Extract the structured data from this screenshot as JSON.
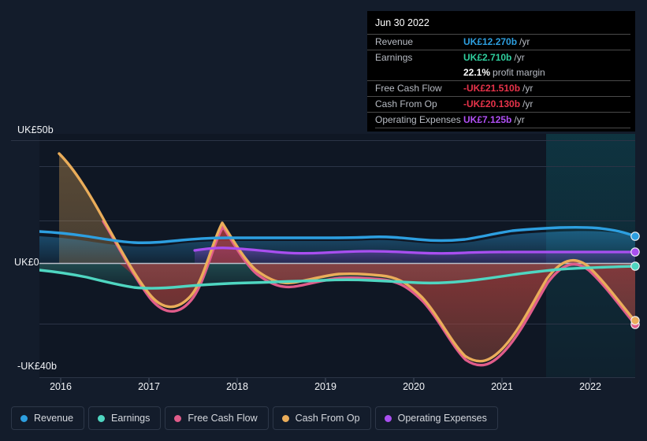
{
  "chart_data": {
    "type": "area",
    "title": "",
    "xlabel": "",
    "ylabel": "",
    "currency": "UK£",
    "unit": "b",
    "ylim": [
      -40,
      50
    ],
    "y_ticks": [
      {
        "label": "UK£50b",
        "value": 50
      },
      {
        "label": "UK£0",
        "value": 0
      },
      {
        "label": "-UK£40b",
        "value": -40
      }
    ],
    "grid": true,
    "x_ticks": [
      "2016",
      "2017",
      "2018",
      "2019",
      "2020",
      "2021",
      "2022"
    ],
    "legend_position": "bottom",
    "forecast_band": {
      "start": "2021.8",
      "label": ""
    },
    "series": [
      {
        "name": "Revenue",
        "color": "#2d9fe0",
        "values": [
          10.5,
          10.3,
          9.8,
          9.6,
          9.7,
          10.2,
          10.6,
          10.8,
          10.9,
          11.0,
          11.1,
          11.2,
          11.0,
          10.7,
          10.6,
          10.8,
          11.1,
          11.4,
          11.8,
          12.0,
          12.1,
          12.2,
          12.27,
          12.3
        ],
        "end_value": 12.27
      },
      {
        "name": "Earnings",
        "color": "#4fd6c1",
        "values": [
          -1.1,
          -1.8,
          -2.6,
          -3.3,
          -3.6,
          -3.4,
          -2.9,
          -2.6,
          -2.5,
          -2.4,
          -2.5,
          -2.6,
          -2.5,
          -2.2,
          -2.0,
          -2.2,
          -2.5,
          -2.3,
          -1.6,
          -0.8,
          0.4,
          1.6,
          2.4,
          2.71
        ],
        "end_value": 2.71
      },
      {
        "name": "Free Cash Flow",
        "color": "#e05c8a",
        "values": [
          null,
          null,
          12.0,
          -5.5,
          -18.5,
          -13.0,
          4.0,
          11.0,
          8.5,
          0.5,
          -5.0,
          -8.5,
          -7.0,
          -4.5,
          -4.0,
          -5.5,
          -9.0,
          -22.0,
          -31.5,
          -24.0,
          -10.5,
          -3.0,
          -8.5,
          -21.51
        ],
        "end_value": -21.51
      },
      {
        "name": "Cash From Op",
        "color": "#eaad5a",
        "values": [
          46.0,
          34.0,
          16.0,
          -3.5,
          -17.0,
          -11.5,
          5.5,
          12.0,
          9.0,
          1.0,
          -4.5,
          -8.0,
          -6.5,
          -4.0,
          -3.5,
          -5.0,
          -8.5,
          -21.0,
          -30.5,
          -23.0,
          -9.5,
          -2.0,
          -7.5,
          -20.13
        ],
        "end_value": -20.13
      },
      {
        "name": "Operating Expenses",
        "color": "#a94ff0",
        "values": [
          null,
          null,
          null,
          null,
          null,
          null,
          5.8,
          6.1,
          6.3,
          6.2,
          6.0,
          5.9,
          5.8,
          5.8,
          5.9,
          6.0,
          6.1,
          6.2,
          6.4,
          6.6,
          6.8,
          7.0,
          7.1,
          7.125
        ],
        "end_value": 7.125
      }
    ]
  },
  "tooltip": {
    "title": "Jun 30 2022",
    "rows": [
      {
        "label": "Revenue",
        "value": "UK£12.270b",
        "suffix": "/yr",
        "color": "#2d9fe0"
      },
      {
        "label": "Earnings",
        "value": "UK£2.710b",
        "suffix": "/yr",
        "color": "#2fcf9e"
      },
      {
        "label": "",
        "value": "22.1%",
        "suffix": "profit margin",
        "color": "#ffffff"
      },
      {
        "label": "Free Cash Flow",
        "value": "-UK£21.510b",
        "suffix": "/yr",
        "color": "#e8334a"
      },
      {
        "label": "Cash From Op",
        "value": "-UK£20.130b",
        "suffix": "/yr",
        "color": "#e8334a"
      },
      {
        "label": "Operating Expenses",
        "value": "UK£7.125b",
        "suffix": "/yr",
        "color": "#b14ff5"
      }
    ]
  },
  "y_axis": {
    "top_label": "UK£50b",
    "zero_label": "UK£0",
    "bottom_label": "-UK£40b"
  },
  "x_axis": {
    "ticks": [
      "2016",
      "2017",
      "2018",
      "2019",
      "2020",
      "2021",
      "2022"
    ]
  },
  "legend": {
    "items": [
      {
        "label": "Revenue",
        "color": "#2d9fe0"
      },
      {
        "label": "Earnings",
        "color": "#4fd6c1"
      },
      {
        "label": "Free Cash Flow",
        "color": "#e05c8a"
      },
      {
        "label": "Cash From Op",
        "color": "#eaad5a"
      },
      {
        "label": "Operating Expenses",
        "color": "#a94ff0"
      }
    ]
  },
  "colors": {
    "background": "#131c2b",
    "grid": "#2b3446",
    "zero_line": "#b9bec9",
    "tooltip_bg": "#000000"
  }
}
